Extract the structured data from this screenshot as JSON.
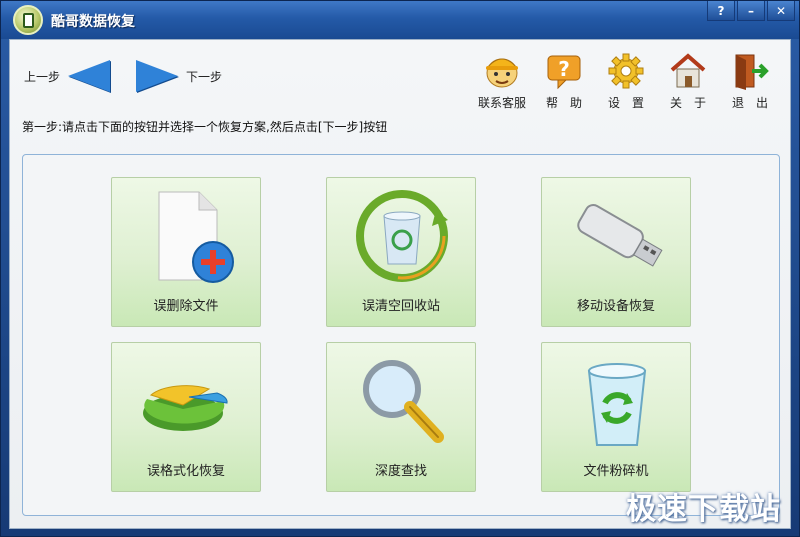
{
  "window": {
    "title": "酷哥数据恢复"
  },
  "window_buttons": {
    "help": "?",
    "minimize": "–",
    "close": "✕"
  },
  "nav": {
    "prev": "上一步",
    "next": "下一步"
  },
  "toolbar": {
    "contact": "联系客服",
    "help": "帮　助",
    "settings": "设　置",
    "about": "关　于",
    "exit": "退　出"
  },
  "instruction": "第一步:请点击下面的按钮并选择一个恢复方案,然后点击[下一步]按钮",
  "cards": [
    {
      "label": "误删除文件"
    },
    {
      "label": "误清空回收站"
    },
    {
      "label": "移动设备恢复"
    },
    {
      "label": "误格式化恢复"
    },
    {
      "label": "深度查找"
    },
    {
      "label": "文件粉碎机"
    }
  ],
  "watermark": "极速下载站"
}
